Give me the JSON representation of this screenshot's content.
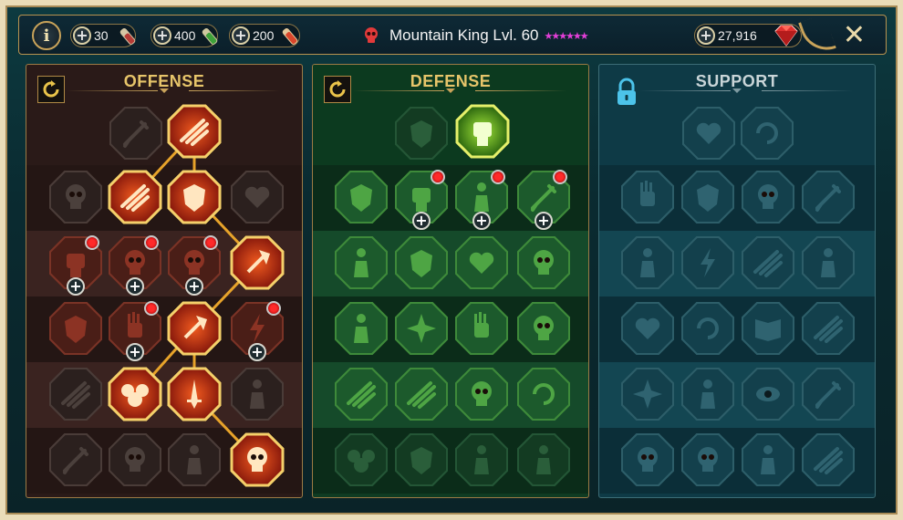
{
  "topbar": {
    "info_label": "i",
    "currencies": [
      {
        "value": "30",
        "icon": "red-potion-vial-icon"
      },
      {
        "value": "400",
        "icon": "green-potion-vial-icon"
      },
      {
        "value": "200",
        "icon": "orange-scroll-icon"
      }
    ],
    "hero": {
      "name": "Mountain King Lvl. 60",
      "stars": "★★★★★★",
      "faction_icon": "red-skull-icon"
    },
    "gems": {
      "value": "27,916",
      "icon": "red-gem-icon"
    },
    "close_label": "✕"
  },
  "panels": [
    {
      "id": "offense",
      "title": "OFFENSE",
      "title_color": "#e7c56a",
      "locked": false
    },
    {
      "id": "defense",
      "title": "DEFENSE",
      "title_color": "#e7c56a",
      "locked": false
    },
    {
      "id": "support",
      "title": "SUPPORT",
      "title_color": "#c9d5d8",
      "locked": true
    }
  ],
  "colors": {
    "offense_active": "#d64a22",
    "defense_active": "#8ed62e",
    "link_gold": "#e7a32a",
    "gold_border": "#c9a35a"
  }
}
